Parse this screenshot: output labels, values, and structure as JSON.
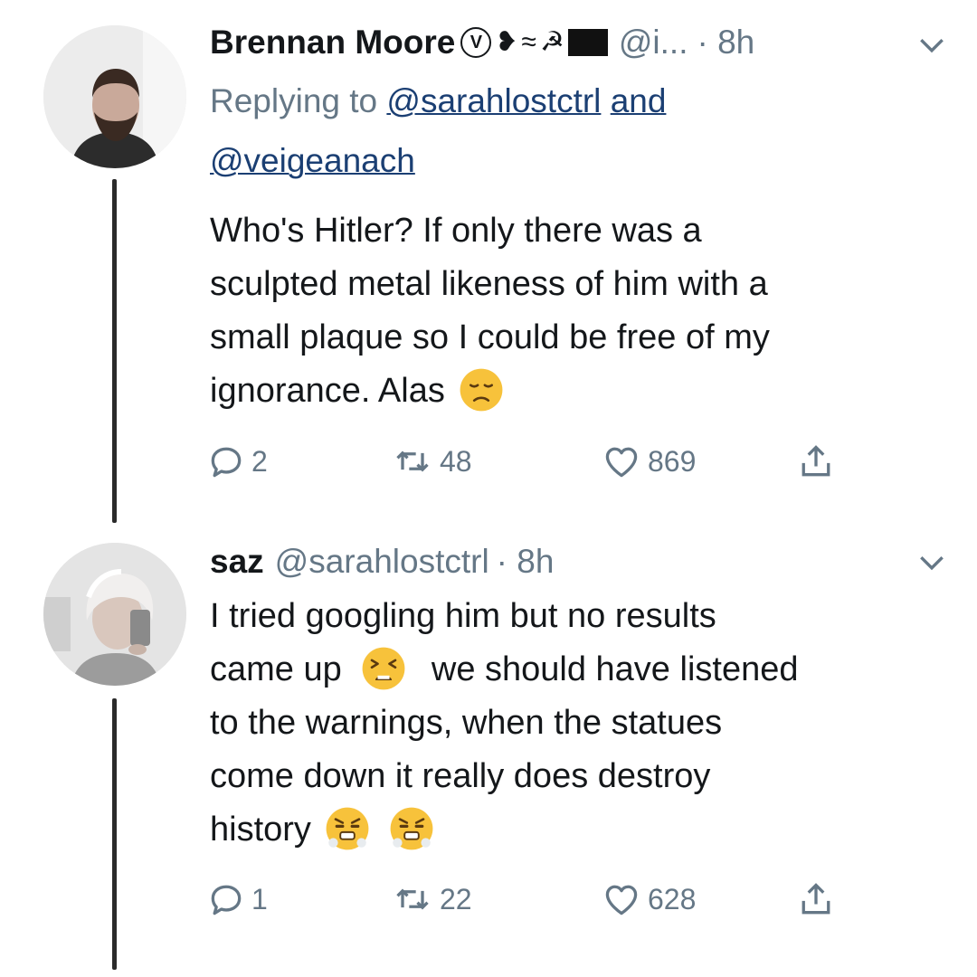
{
  "tweets": [
    {
      "display_name": "Brennan Moore",
      "badges": [
        "V",
        "❥",
        "≈",
        "☭",
        "▬"
      ],
      "handle": "@i...",
      "time": "· 8h",
      "replying_prefix": "Replying to",
      "replying_to_1": "@sarahlostctrl",
      "replying_and": "and",
      "replying_to_2": "@veigeanach",
      "body_lines": [
        "Who's Hitler? If only there was a",
        "sculpted metal likeness of him with a",
        "small plaque so I could be free of my",
        "ignorance. Alas"
      ],
      "emoji_end": "disappointed-face-emoji",
      "replies": "2",
      "retweets": "48",
      "likes": "869"
    },
    {
      "display_name": "saz",
      "handle": "@sarahlostctrl",
      "time": "· 8h",
      "body_lines": [
        "I tried googling him but no results",
        "came up",
        "we should have listened",
        "to the warnings, when the statues",
        "come down it really does destroy",
        "history"
      ],
      "emojis": [
        "tired-face-emoji",
        "steam-face-emoji",
        "steam-face-emoji"
      ],
      "replies": "1",
      "retweets": "22",
      "likes": "628"
    }
  ],
  "colors": {
    "text": "#14171a",
    "muted": "#657786",
    "link": "#1b3f73",
    "emoji_yellow": "#f7c23b"
  }
}
